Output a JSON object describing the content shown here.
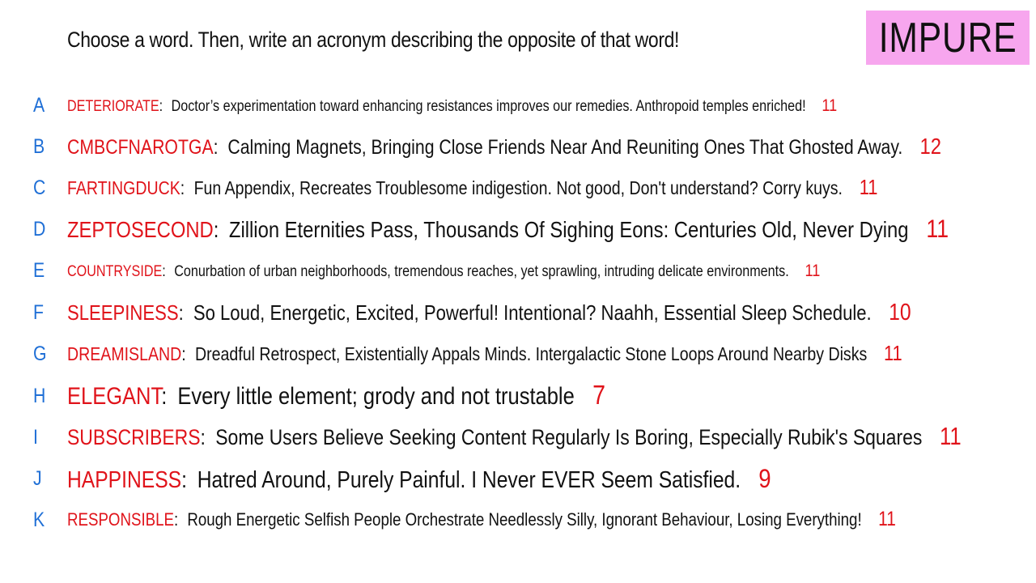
{
  "prompt": "Choose a word. Then, write an acronym describing the opposite of that word!",
  "badge": "IMPURE",
  "rows": [
    {
      "letter": "A",
      "word": "DETERIORATE",
      "phrase": "Doctor’s experimentation toward enhancing resistances improves our remedies. Anthropoid temples enriched!",
      "count": "11"
    },
    {
      "letter": "B",
      "word": "CMBCFNAROTGA",
      "phrase": "Calming Magnets, Bringing Close Friends Near And Reuniting Ones That Ghosted Away.",
      "count": "12"
    },
    {
      "letter": "C",
      "word": "FARTINGDUCK",
      "phrase": "Fun Appendix, Recreates Troublesome indigestion. Not good, Don't understand? Corry kuys.",
      "count": "11"
    },
    {
      "letter": "D",
      "word": "ZEPTOSECOND",
      "phrase": "Zillion Eternities Pass, Thousands Of Sighing Eons: Centuries Old, Never Dying",
      "count": "11"
    },
    {
      "letter": "E",
      "word": "COUNTRYSIDE",
      "phrase": "Conurbation of urban neighborhoods, tremendous reaches, yet sprawling, intruding delicate environments.",
      "count": "11"
    },
    {
      "letter": "F",
      "word": "SLEEPINESS",
      "phrase": "So Loud, Energetic, Excited, Powerful! Intentional? Naahh, Essential Sleep Schedule.",
      "count": "10"
    },
    {
      "letter": "G",
      "word": "DREAMISLAND",
      "phrase": "Dreadful Retrospect, Existentially Appals Minds. Intergalactic Stone Loops Around Nearby Disks",
      "count": "11"
    },
    {
      "letter": "H",
      "word": "ELEGANT",
      "phrase": "Every little element; grody and not trustable",
      "count": "7"
    },
    {
      "letter": "I",
      "word": "SUBSCRIBERS",
      "phrase": "Some Users Believe Seeking Content Regularly Is Boring, Especially Rubik's Squares",
      "count": "11"
    },
    {
      "letter": "J",
      "word": "HAPPINESS",
      "phrase": "Hatred Around, Purely Painful. I Never EVER Seem Satisfied.",
      "count": "9"
    },
    {
      "letter": "K",
      "word": "RESPONSIBLE",
      "phrase": "Rough Energetic Selfish People Orchestrate Needlessly Silly, Ignorant Behaviour, Losing Everything!",
      "count": "11"
    }
  ]
}
